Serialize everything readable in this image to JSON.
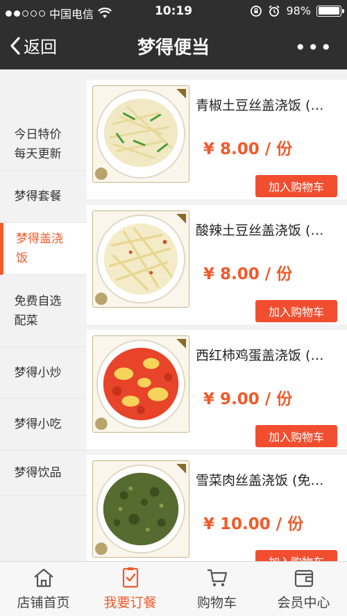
{
  "status_bar": {
    "carrier": "中国电信",
    "time": "10:19",
    "battery": "98%",
    "battery_level": 0.98
  },
  "nav": {
    "back_label": "返回",
    "title": "梦得便当",
    "more_label": "•••"
  },
  "categories": [
    {
      "label": "今日特价每天更新",
      "active": false
    },
    {
      "label": "梦得套餐",
      "active": false
    },
    {
      "label": "梦得盖浇饭",
      "active": true
    },
    {
      "label": "免费自选配菜",
      "active": false
    },
    {
      "label": "梦得小炒",
      "active": false
    },
    {
      "label": "梦得小吃",
      "active": false
    },
    {
      "label": "梦得饮品",
      "active": false
    }
  ],
  "products": [
    {
      "name": "青椒土豆丝盖浇饭 (…",
      "price": "¥ 8.00 / 份",
      "add_label": "加入购物车",
      "dish": "pepper-potato"
    },
    {
      "name": "酸辣土豆丝盖浇饭 (…",
      "price": "¥ 8.00 / 份",
      "add_label": "加入购物车",
      "dish": "spicy-potato"
    },
    {
      "name": "西红柿鸡蛋盖浇饭 (…",
      "price": "¥ 9.00 / 份",
      "add_label": "加入购物车",
      "dish": "tomato-egg"
    },
    {
      "name": "雪菜肉丝盖浇饭 (免…",
      "price": "¥ 10.00 / 份",
      "add_label": "加入购物车",
      "dish": "pickled-greens-pork"
    }
  ],
  "tabs": [
    {
      "label": "店铺首页",
      "icon": "home-icon",
      "active": false
    },
    {
      "label": "我要订餐",
      "icon": "order-icon",
      "active": true
    },
    {
      "label": "购物车",
      "icon": "cart-icon",
      "active": false
    },
    {
      "label": "会员中心",
      "icon": "wallet-icon",
      "active": false
    }
  ],
  "colors": {
    "accent": "#f15a2b",
    "button": "#f14e30",
    "header": "#2f2f2f"
  }
}
